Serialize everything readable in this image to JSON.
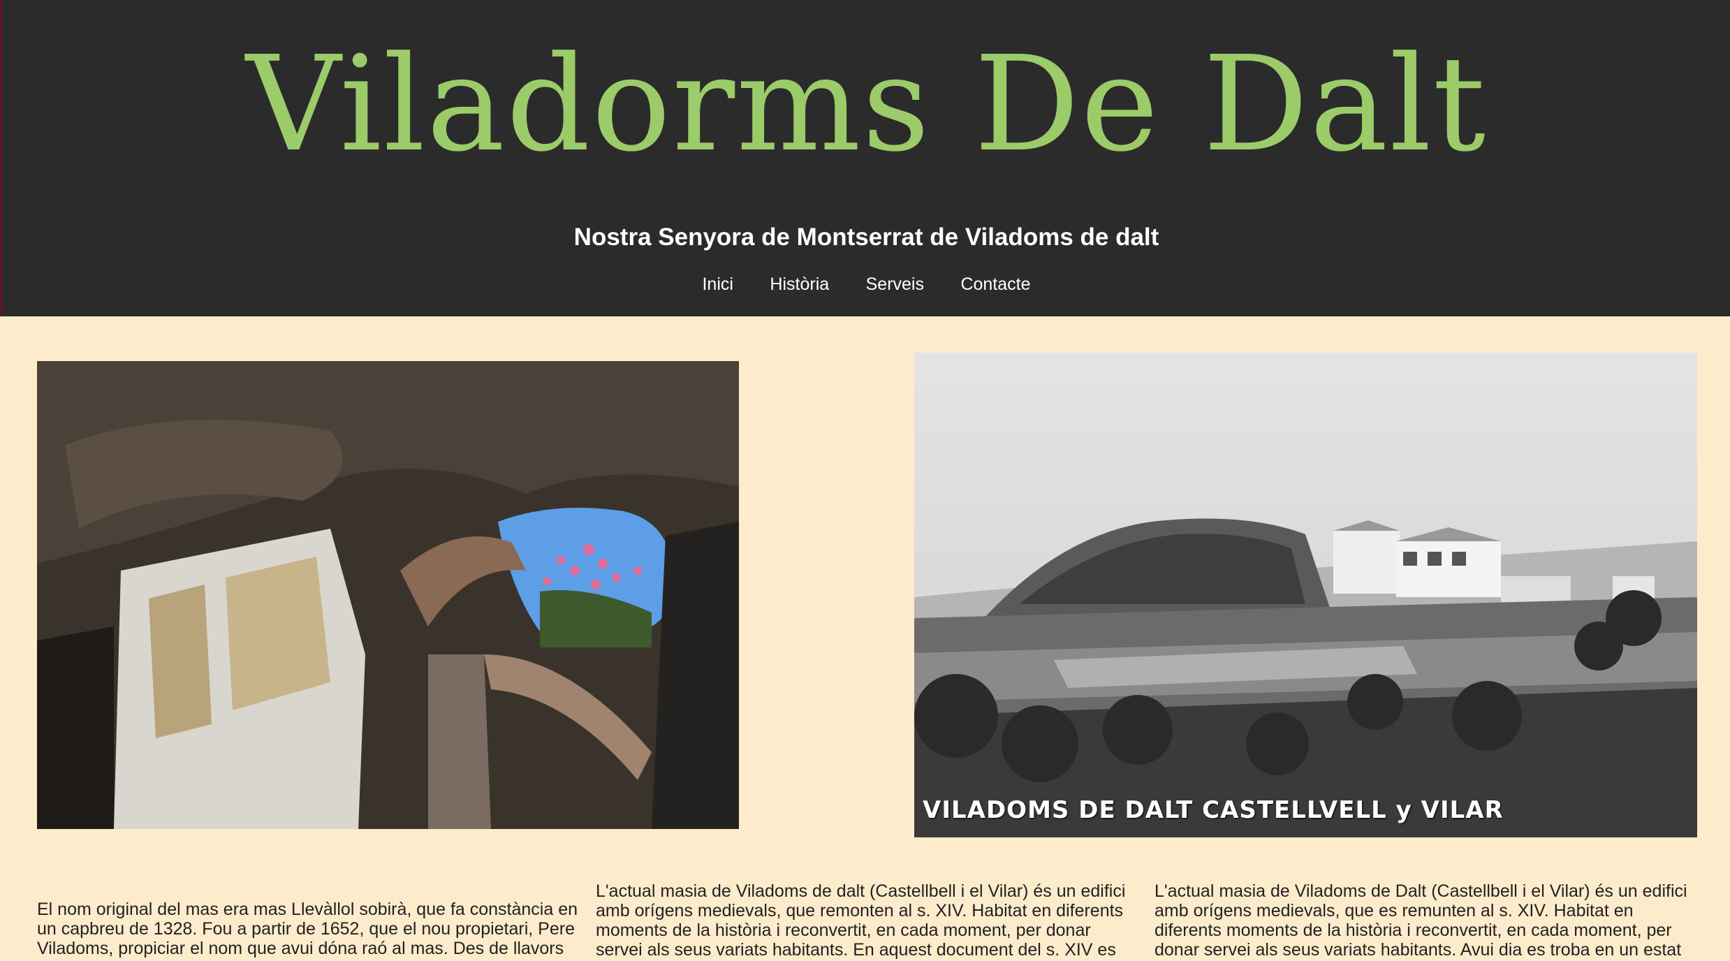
{
  "header": {
    "logo_text": "Viladorms De Dalt",
    "subtitle": "Nostra Senyora de Montserrat de Viladoms de dalt",
    "nav": [
      {
        "label": "Inici"
      },
      {
        "label": "Història"
      },
      {
        "label": "Serveis"
      },
      {
        "label": "Contacte"
      }
    ]
  },
  "photos": {
    "ruins_alt": "Ruins with arch and flowers",
    "postcard_caption": "VILADOMS DE DALT  CASTELLVELL y VILAR"
  },
  "columns": [
    {
      "text": "El nom original del mas era mas Llevàllol sobirà, que fa constància en un capbreu de 1328. Fou a partir de 1652, que el nou propietari, Pere Viladoms, propiciar el nom que avui dóna raó al mas. Des de llavors"
    },
    {
      "text": "L'actual masia de Viladoms de dalt (Castellbell i el Vilar) és un edifici amb orígens medievals, que remonten al s. XIV. Habitat en diferents moments de la història i reconvertit, en cada moment, per donar servei als seus variats habitants. En aquest document del s. XIV es citen dos"
    },
    {
      "text": "L'actual masia de Viladoms de Dalt (Castellbell i el Vilar) és un edifici amb orígens medievals, que es remunten al s. XIV. Habitat en diferents moments de la història i reconvertit, en cada moment, per donar servei als seus variats habitants. Avui dia es troba en un estat desolador,"
    }
  ],
  "colors": {
    "header_bg": "#2b2b2b",
    "logo": "#9ccb6a",
    "page_bg": "#fdeccb"
  }
}
